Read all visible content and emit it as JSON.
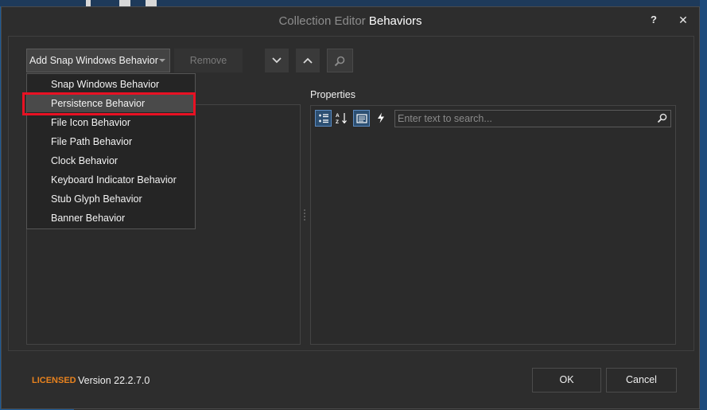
{
  "colors": {
    "accent_blue": "#5b8ac0",
    "licensed_orange": "#e8821e",
    "highlight_red": "#e81123",
    "background": "#2d2d2d"
  },
  "window": {
    "title_prefix": "Collection Editor",
    "title_name": "Behaviors",
    "help_label": "?",
    "close_label": "✕"
  },
  "toolbar": {
    "add_label": "Add Snap Windows Behavior",
    "remove_label": "Remove",
    "icons": [
      "chevron-down-icon",
      "chevron-up-icon",
      "search-icon"
    ]
  },
  "menu": {
    "items": [
      "Snap Windows Behavior",
      "Persistence Behavior",
      "File Icon Behavior",
      "File Path Behavior",
      "Clock Behavior",
      "Keyboard Indicator Behavior",
      "Stub Glyph Behavior",
      "Banner Behavior"
    ],
    "highlighted": "Persistence Behavior"
  },
  "properties": {
    "label": "Properties",
    "search_placeholder": "Enter text to search...",
    "tool_icons": [
      "categorized-icon",
      "alphabetical-icon",
      "property-pages-icon",
      "events-icon"
    ]
  },
  "footer": {
    "licensed": "LICENSED",
    "version": "Version 22.2.7.0",
    "ok_label": "OK",
    "cancel_label": "Cancel"
  }
}
